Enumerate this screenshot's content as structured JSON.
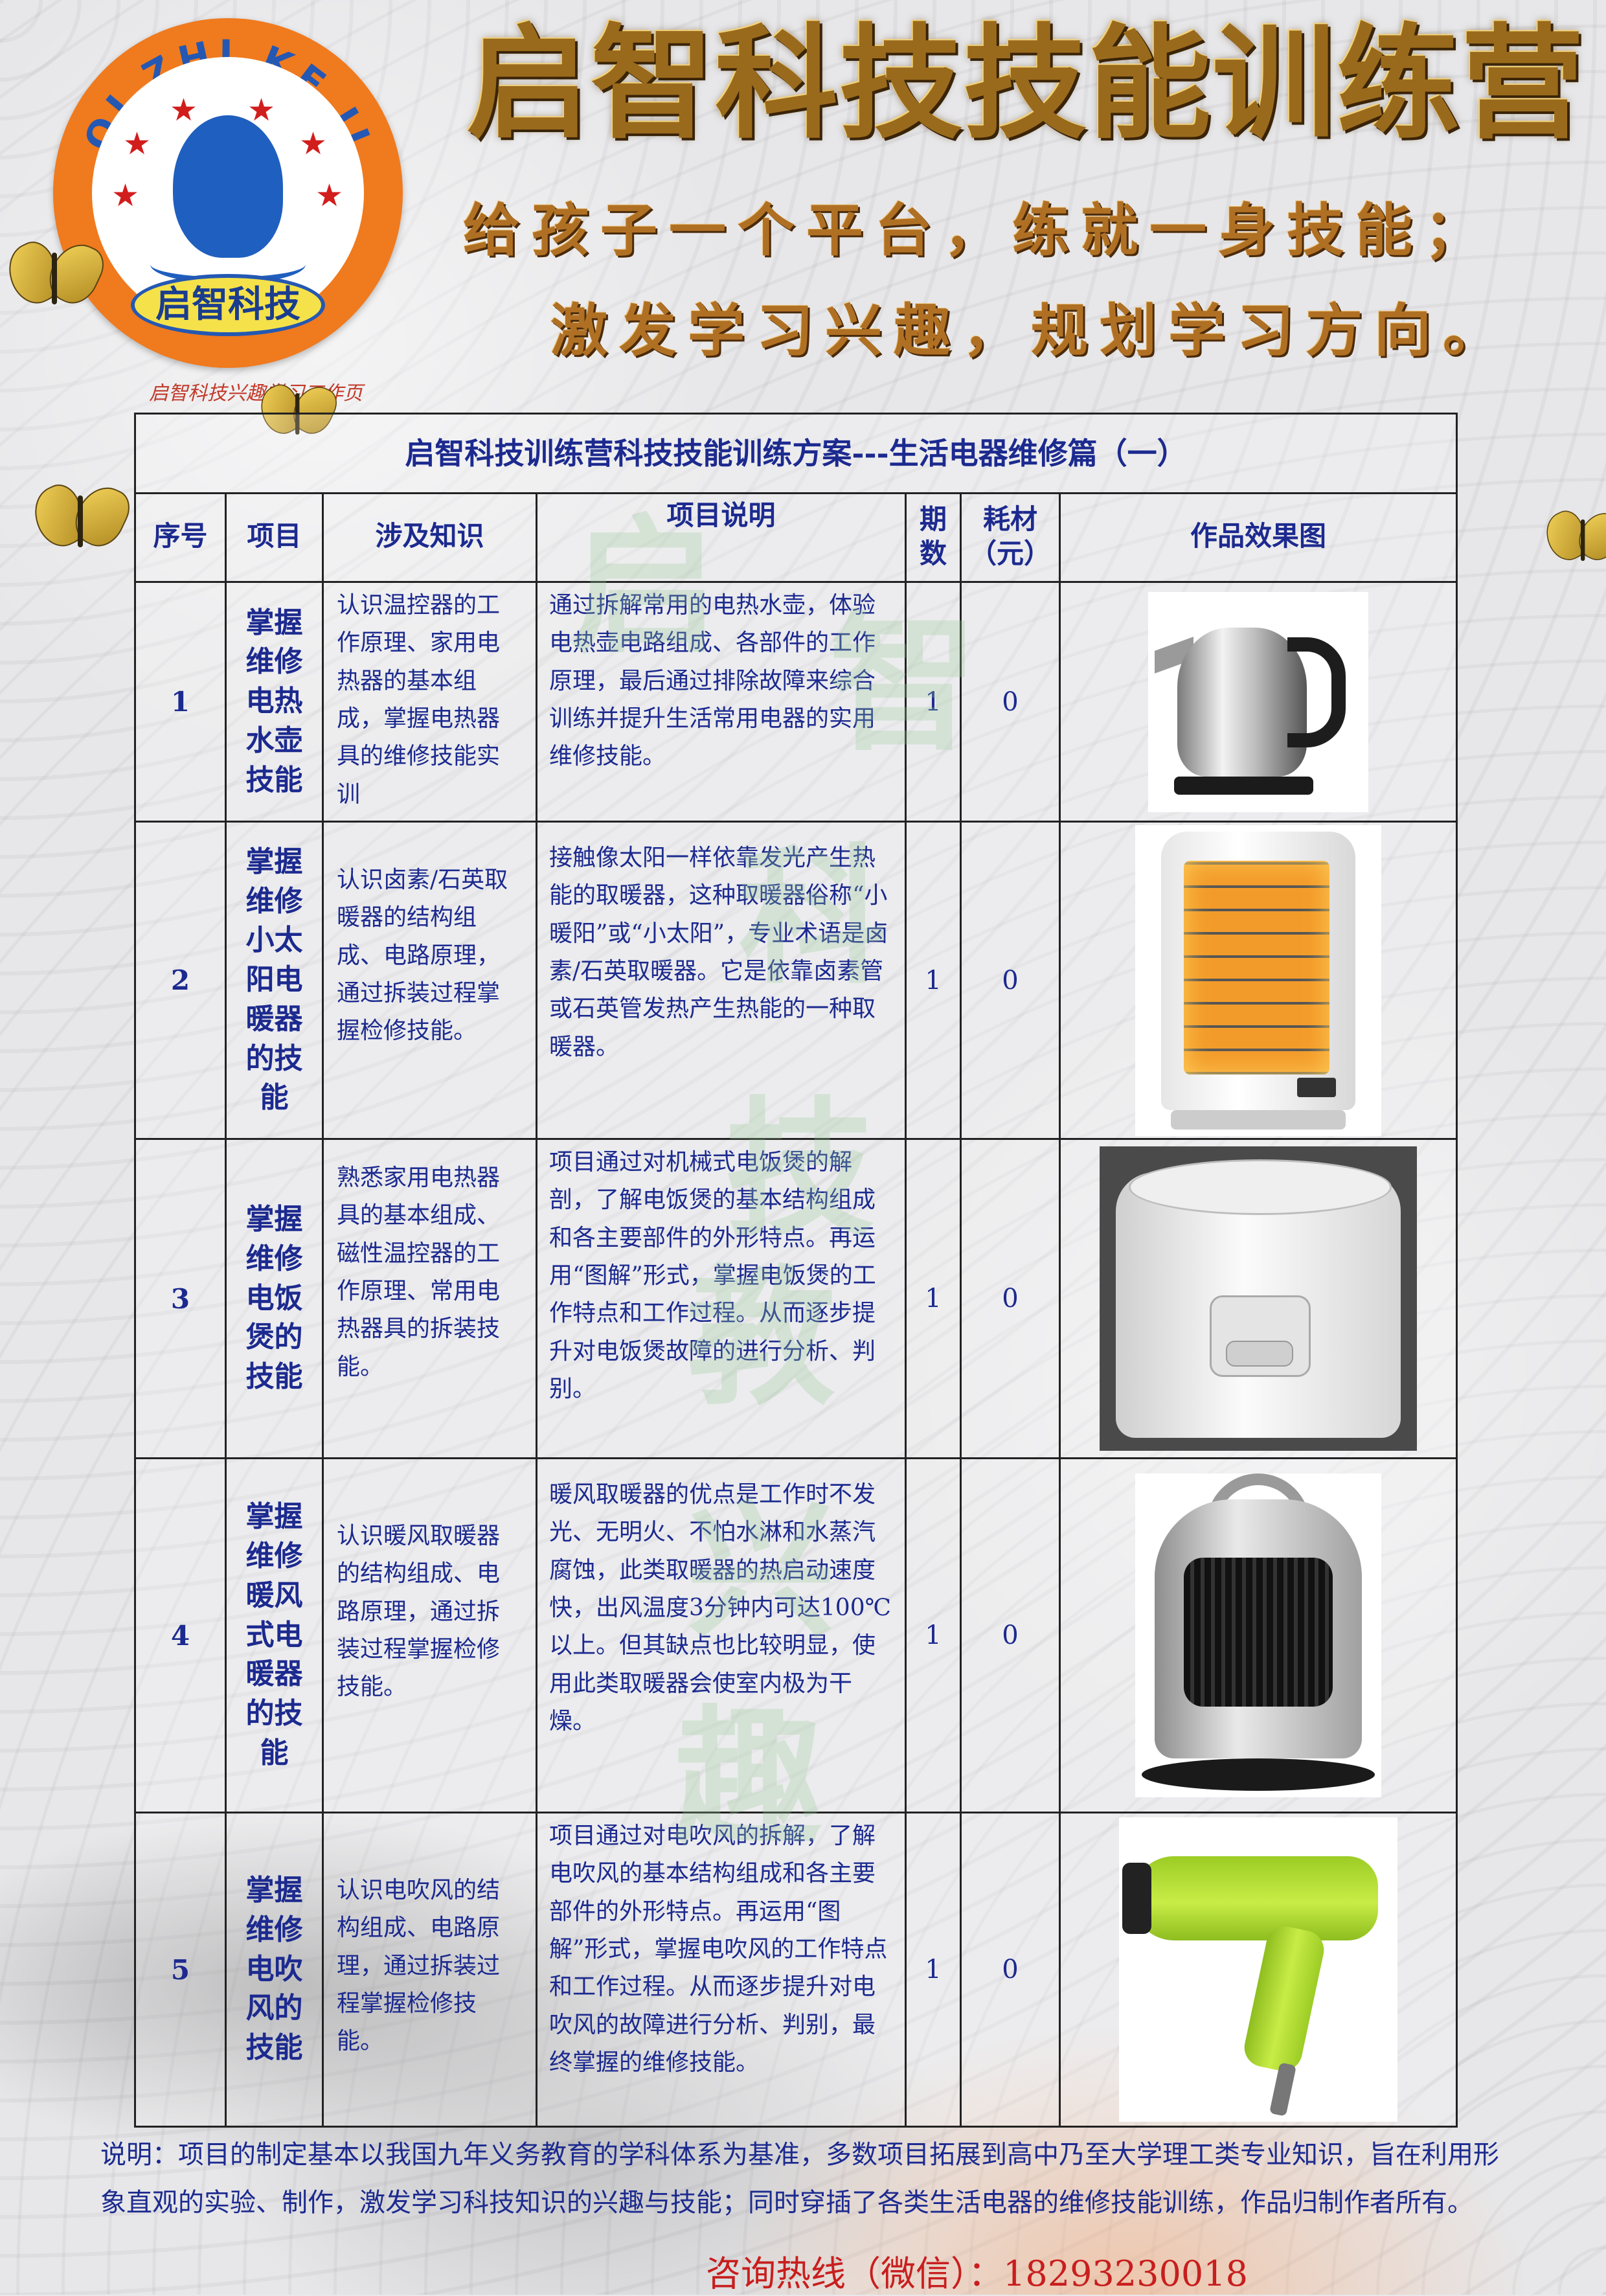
{
  "brand": {
    "logo_ring_text": "QI ZHI KE JI",
    "logo_badge": "启智科技",
    "sub_caption": "启智科技兴趣学习工作页"
  },
  "header": {
    "title": "启智科技技能训练营",
    "slogan_line1": "给孩子一个平台，练就一身技能；",
    "slogan_line2": "激发学习兴趣，规划学习方向。"
  },
  "table": {
    "title": "启智科技训练营科技技能训练方案---生活电器维修篇（一）",
    "headers": {
      "index": "序号",
      "project": "项目",
      "knowledge": "涉及知识",
      "description": "项目说明",
      "periods": "期数",
      "cost": "耗材（元）",
      "result": "作品效果图"
    },
    "rows": [
      {
        "index": "1",
        "project": "掌握维修电热水壶技能",
        "knowledge": "认识温控器的工作原理、家用电热器的基本组成，掌握电热器具的维修技能实训",
        "description": "通过拆解常用的电热水壶，体验电热壶电路组成、各部件的工作原理，最后通过排除故障来综合训练并提升生活常用电器的实用维修技能。",
        "periods": "1",
        "cost": "0",
        "image": "electric-kettle"
      },
      {
        "index": "2",
        "project": "掌握维修小太阳电暖器的技能",
        "knowledge": "认识卤素/石英取暖器的结构组成、电路原理，通过拆装过程掌握检修技能。",
        "description": "接触像太阳一样依靠发光产生热能的取暖器，这种取暖器俗称“小暖阳”或“小太阳”，专业术语是卤素/石英取暖器。它是依靠卤素管或石英管发热产生热能的一种取暖器。",
        "periods": "1",
        "cost": "0",
        "image": "halogen-heater"
      },
      {
        "index": "3",
        "project": "掌握维修电饭煲的技能",
        "knowledge": "熟悉家用电热器具的基本组成、磁性温控器的工作原理、常用电热器具的拆装技能。",
        "description": "项目通过对机械式电饭煲的解剖，了解电饭煲的基本结构组成和各主要部件的外形特点。再运用“图解”形式，掌握电饭煲的工作特点和工作过程。从而逐步提升对电饭煲故障的进行分析、判别。",
        "periods": "1",
        "cost": "0",
        "image": "rice-cooker"
      },
      {
        "index": "4",
        "project": "掌握维修暖风式电暖器的技能",
        "knowledge": "认识暖风取暖器的结构组成、电路原理，通过拆装过程掌握检修技能。",
        "description": "暖风取暖器的优点是工作时不发光、无明火、不怕水淋和水蒸汽腐蚀，此类取暖器的热启动速度快，出风温度3分钟内可达100℃以上。但其缺点也比较明显，使用此类取暖器会使室内极为干燥。",
        "periods": "1",
        "cost": "0",
        "image": "fan-heater"
      },
      {
        "index": "5",
        "project": "掌握维修电吹风的技能",
        "knowledge": "认识电吹风的结构组成、电路原理，通过拆装过程掌握检修技能。",
        "description": "项目通过对电吹风的拆解，了解电吹风的基本结构组成和各主要部件的外形特点。再运用“图解”形式，掌握电吹风的工作特点和工作过程。从而逐步提升对电吹风的故障进行分析、判别，最终掌握的维修技能。",
        "periods": "1",
        "cost": "0",
        "image": "hair-dryer"
      }
    ]
  },
  "watermark": {
    "chars": [
      "启",
      "智",
      "科",
      "技",
      "教",
      "兴",
      "趣"
    ]
  },
  "footer": {
    "note": "说明：项目的制定基本以我国九年义务教育的学科体系为基准，多数项目拓展到高中乃至大学理工类专业知识，旨在利用形象直观的实验、制作，激发学习科技知识的兴趣与技能；同时穿插了各类生活电器的维修技能训练，作品归制作者所有。",
    "hotline": "咨询热线（微信）：18293230018"
  }
}
